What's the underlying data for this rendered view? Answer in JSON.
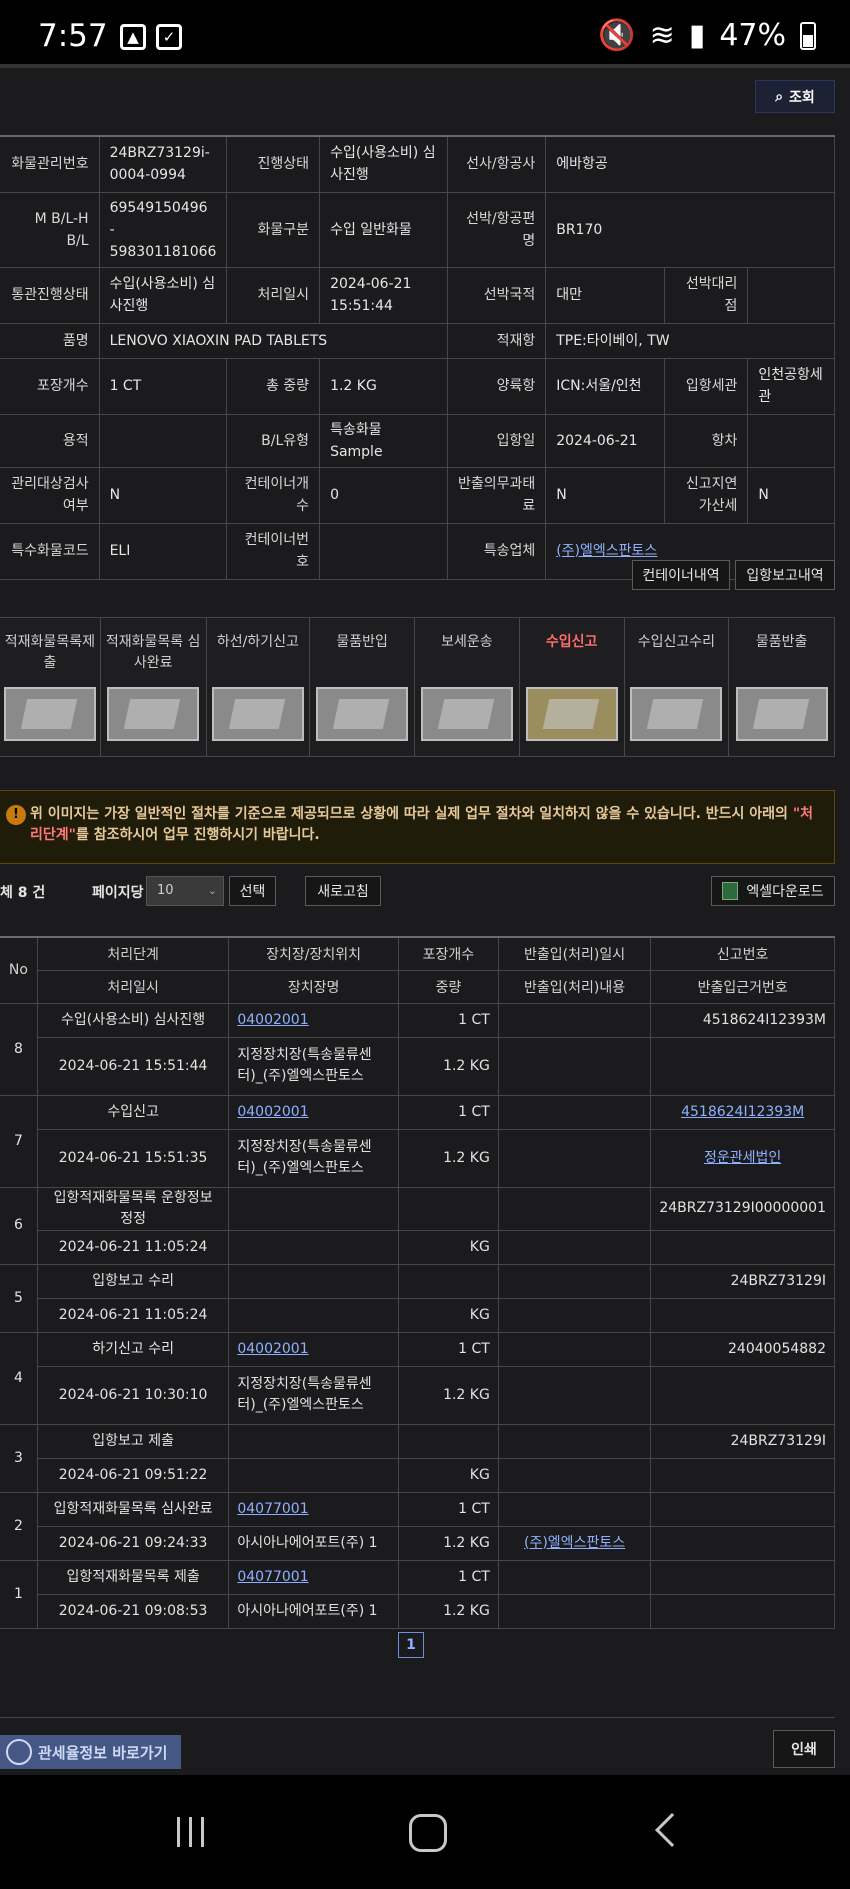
{
  "status": {
    "time": "7:57",
    "battery": "47%"
  },
  "search_button": "조회",
  "info_rows": [
    [
      [
        "화물관리번호",
        "label"
      ],
      [
        "24BRZ73129i-0004-0994",
        "value"
      ],
      [
        "진행상태",
        "label"
      ],
      [
        "수입(사용소비) 심사진행",
        "value"
      ],
      [
        "선사/항공사",
        "label"
      ],
      [
        "에바항공",
        "value",
        3
      ]
    ],
    [
      [
        "M B/L-H B/L",
        "label"
      ],
      [
        "69549150496 - 598301181066",
        "value"
      ],
      [
        "화물구분",
        "label"
      ],
      [
        "수입 일반화물",
        "value"
      ],
      [
        "선박/항공편명",
        "label"
      ],
      [
        "BR170",
        "value",
        3
      ]
    ],
    [
      [
        "통관진행상태",
        "label"
      ],
      [
        "수입(사용소비) 심사진행",
        "value"
      ],
      [
        "처리일시",
        "label"
      ],
      [
        "2024-06-21 15:51:44",
        "value"
      ],
      [
        "선박국적",
        "label"
      ],
      [
        "대만",
        "value"
      ],
      [
        "선박대리점",
        "label"
      ],
      [
        "",
        "value"
      ]
    ],
    [
      [
        "품명",
        "label"
      ],
      [
        "LENOVO XIAOXIN PAD TABLETS",
        "value",
        3
      ],
      [
        "적재항",
        "label"
      ],
      [
        "TPE:타이베이, TW",
        "value",
        3
      ]
    ],
    [
      [
        "포장개수",
        "label"
      ],
      [
        "1 CT",
        "value"
      ],
      [
        "총 중량",
        "label"
      ],
      [
        "1.2 KG",
        "value"
      ],
      [
        "양륙항",
        "label"
      ],
      [
        "ICN:서울/인천",
        "value"
      ],
      [
        "입항세관",
        "label"
      ],
      [
        "인천공항세관",
        "value"
      ]
    ],
    [
      [
        "용적",
        "label"
      ],
      [
        "",
        "value"
      ],
      [
        "B/L유형",
        "label"
      ],
      [
        "특송화물 Sample",
        "value"
      ],
      [
        "입항일",
        "label"
      ],
      [
        "2024-06-21",
        "value"
      ],
      [
        "항차",
        "label"
      ],
      [
        "",
        "value"
      ]
    ],
    [
      [
        "관리대상검사여부",
        "label"
      ],
      [
        "N",
        "value"
      ],
      [
        "컨테이너개수",
        "label"
      ],
      [
        "0",
        "value"
      ],
      [
        "반출의무과태료",
        "label"
      ],
      [
        "N",
        "value"
      ],
      [
        "신고지연가산세",
        "label"
      ],
      [
        "N",
        "value"
      ]
    ],
    [
      [
        "특수화물코드",
        "label"
      ],
      [
        "ELI",
        "value"
      ],
      [
        "컨테이너번호",
        "label"
      ],
      [
        "",
        "value"
      ],
      [
        "특송업체",
        "label"
      ],
      [
        "(주)엘엑스판토스",
        "link",
        3
      ]
    ]
  ],
  "buttons": {
    "container_history": "컨테이너내역",
    "arrival_report_history": "입항보고내역",
    "select": "선택",
    "refresh": "새로고침",
    "excel": "엑셀다운로드",
    "print": "인쇄"
  },
  "steps": [
    {
      "label": "적재화물목록제출",
      "active": false
    },
    {
      "label": "적재화물목록 심사완료",
      "active": false
    },
    {
      "label": "하선/하기신고",
      "active": false
    },
    {
      "label": "물품반입",
      "active": false
    },
    {
      "label": "보세운송",
      "active": false
    },
    {
      "label": "수입신고",
      "active": true
    },
    {
      "label": "수입신고수리",
      "active": false
    },
    {
      "label": "물품반출",
      "active": false
    }
  ],
  "notice": {
    "before": "위 이미지는 가장 일반적인 절차를 기준으로 제공되므로 상황에 따라 실제 업무 절차와 일치하지 않을 수 있습니다. 반드시 아래의 ",
    "highlight": "\"처리단계\"",
    "after": "를 참조하시어 업무 진행하시기 바랍니다."
  },
  "list_controls": {
    "total": "체 8 건",
    "per_page_label": "페이지당",
    "per_page_value": "10"
  },
  "table_headers": {
    "no": "No",
    "row1": [
      "처리단계",
      "장치장/장치위치",
      "포장개수",
      "반출입(처리)일시",
      "신고번호"
    ],
    "row2": [
      "처리일시",
      "장치장명",
      "중량",
      "반출입(처리)내용",
      "반출입근거번호"
    ]
  },
  "records": [
    {
      "no": "8",
      "step": "수입(사용소비) 심사진행",
      "location": "04002001",
      "package": "1 CT",
      "io_datetime": "",
      "report_no": "4518624I12393M",
      "report_link": false,
      "datetime": "2024-06-21 15:51:44",
      "location_name": "지정장치장(특송물류센터)_(주)엘엑스판토스",
      "weight": "1.2 KG",
      "io_content": "",
      "io_content_link": false,
      "basis_no": "",
      "basis_link": false
    },
    {
      "no": "7",
      "step": "수입신고",
      "location": "04002001",
      "package": "1 CT",
      "io_datetime": "",
      "report_no": "4518624I12393M",
      "report_link": true,
      "datetime": "2024-06-21 15:51:35",
      "location_name": "지정장치장(특송물류센터)_(주)엘엑스판토스",
      "weight": "1.2 KG",
      "io_content": "",
      "io_content_link": false,
      "basis_no": "정운관세법인",
      "basis_link": true
    },
    {
      "no": "6",
      "step": "입항적재화물목록 운항정보 정정",
      "location": "",
      "package": "",
      "io_datetime": "",
      "report_no": "24BRZ73129I00000001",
      "report_link": false,
      "datetime": "2024-06-21 11:05:24",
      "location_name": "",
      "weight": "KG",
      "io_content": "",
      "io_content_link": false,
      "basis_no": "",
      "basis_link": false
    },
    {
      "no": "5",
      "step": "입항보고 수리",
      "location": "",
      "package": "",
      "io_datetime": "",
      "report_no": "24BRZ73129I",
      "report_link": false,
      "datetime": "2024-06-21 11:05:24",
      "location_name": "",
      "weight": "KG",
      "io_content": "",
      "io_content_link": false,
      "basis_no": "",
      "basis_link": false
    },
    {
      "no": "4",
      "step": "하기신고 수리",
      "location": "04002001",
      "package": "1 CT",
      "io_datetime": "",
      "report_no": "24040054882",
      "report_link": false,
      "datetime": "2024-06-21 10:30:10",
      "location_name": "지정장치장(특송물류센터)_(주)엘엑스판토스",
      "weight": "1.2 KG",
      "io_content": "",
      "io_content_link": false,
      "basis_no": "",
      "basis_link": false
    },
    {
      "no": "3",
      "step": "입항보고 제출",
      "location": "",
      "package": "",
      "io_datetime": "",
      "report_no": "24BRZ73129I",
      "report_link": false,
      "datetime": "2024-06-21 09:51:22",
      "location_name": "",
      "weight": "KG",
      "io_content": "",
      "io_content_link": false,
      "basis_no": "",
      "basis_link": false
    },
    {
      "no": "2",
      "step": "입항적재화물목록 심사완료",
      "location": "04077001",
      "package": "1 CT",
      "io_datetime": "",
      "report_no": "",
      "report_link": false,
      "datetime": "2024-06-21 09:24:33",
      "location_name": "아시아나에어포트(주) 1",
      "weight": "1.2 KG",
      "io_content": "(주)엘엑스판토스",
      "io_content_link": true,
      "basis_no": "",
      "basis_link": false
    },
    {
      "no": "1",
      "step": "입항적재화물목록 제출",
      "location": "04077001",
      "package": "1 CT",
      "io_datetime": "",
      "report_no": "",
      "report_link": false,
      "datetime": "2024-06-21 09:08:53",
      "location_name": "아시아나에어포트(주) 1",
      "weight": "1.2 KG",
      "io_content": "",
      "io_content_link": false,
      "basis_no": "",
      "basis_link": false
    }
  ],
  "pagination": {
    "current": "1"
  },
  "banner": "관세율정보 바로가기"
}
